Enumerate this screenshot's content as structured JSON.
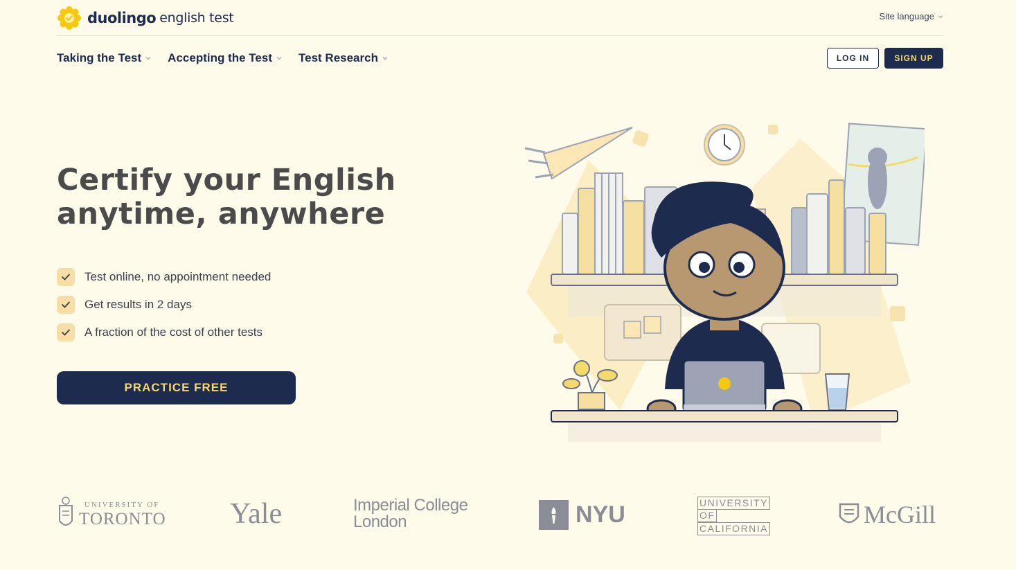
{
  "brand": {
    "name": "duolingo",
    "product": "english test",
    "logo_icon": "duolingo-sun-icon",
    "accent_color": "#f6c90e",
    "navy": "#1d2b4e",
    "cta_text_color": "#f6d96b",
    "background": "#fffbea"
  },
  "header": {
    "site_language": "Site language"
  },
  "nav": {
    "items": [
      {
        "label": "Taking the Test"
      },
      {
        "label": "Accepting the Test"
      },
      {
        "label": "Test Research"
      }
    ],
    "login_label": "LOG IN",
    "signup_label": "SIGN UP"
  },
  "hero": {
    "title_line1": "Certify your English",
    "title_line2": "anytime, anywhere",
    "features": [
      {
        "text": "Test online, no appointment needed",
        "icon": "check-icon"
      },
      {
        "text": "Get results in 2 days",
        "icon": "check-icon"
      },
      {
        "text": "A fraction of the cost of other tests",
        "icon": "check-icon"
      }
    ],
    "cta_label": "PRACTICE FREE"
  },
  "partners": {
    "toronto_line1": "UNIVERSITY OF",
    "toronto_line2": "TORONTO",
    "yale": "Yale",
    "imperial_line1": "Imperial College",
    "imperial_line2": "London",
    "nyu": "NYU",
    "uc_line1": "UNIVERSITY",
    "uc_line2": "OF",
    "uc_line3": "CALIFORNIA",
    "mcgill": "McGill"
  }
}
